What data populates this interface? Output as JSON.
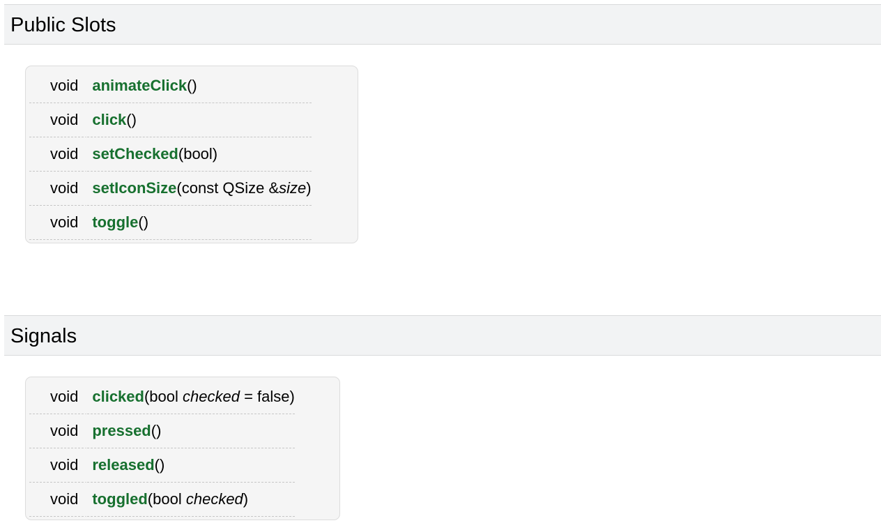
{
  "sections": [
    {
      "title": "Public Slots",
      "members": [
        {
          "ret": "void",
          "name": "animateClick",
          "params": []
        },
        {
          "ret": "void",
          "name": "click",
          "params": []
        },
        {
          "ret": "void",
          "name": "setChecked",
          "params": [
            {
              "type": "bool"
            }
          ]
        },
        {
          "ret": "void",
          "name": "setIconSize",
          "params": [
            {
              "type": "const QSize &",
              "pname": "size"
            }
          ]
        },
        {
          "ret": "void",
          "name": "toggle",
          "params": []
        }
      ]
    },
    {
      "title": "Signals",
      "members": [
        {
          "ret": "void",
          "name": "clicked",
          "params": [
            {
              "type": "bool ",
              "pname": "checked",
              "default": " = false"
            }
          ]
        },
        {
          "ret": "void",
          "name": "pressed",
          "params": []
        },
        {
          "ret": "void",
          "name": "released",
          "params": []
        },
        {
          "ret": "void",
          "name": "toggled",
          "params": [
            {
              "type": "bool ",
              "pname": "checked"
            }
          ]
        }
      ]
    }
  ],
  "colors": {
    "link": "#17702f",
    "header_bg": "#f2f3f4",
    "box_bg": "#f5f5f5"
  }
}
